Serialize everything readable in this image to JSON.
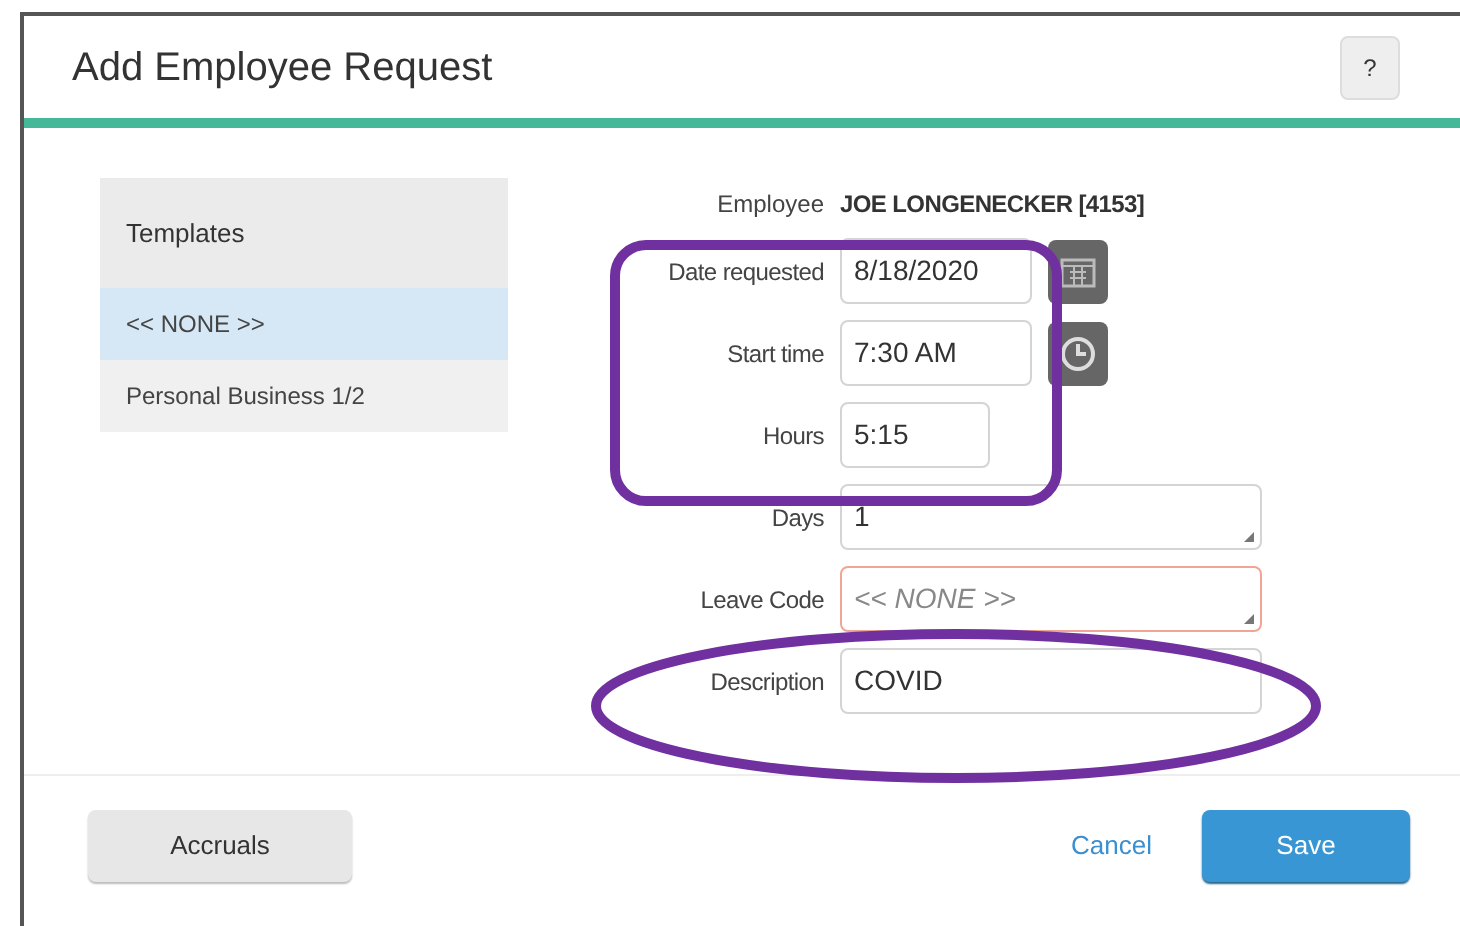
{
  "dialog": {
    "title": "Add Employee Request",
    "help_button": "?"
  },
  "templates": {
    "header": "Templates",
    "items": [
      {
        "label": "<< NONE >>",
        "selected": true
      },
      {
        "label": "Personal Business 1/2",
        "selected": false
      }
    ]
  },
  "employee": {
    "label": "Employee",
    "value": "JOE LONGENECKER [4153]"
  },
  "fields": [
    {
      "label": "Date requested",
      "value": "8/18/2020",
      "kind": "date",
      "invalid": false
    },
    {
      "label": "Start time",
      "value": "7:30 AM",
      "kind": "time",
      "invalid": false
    },
    {
      "label": "Hours",
      "value": "5:15",
      "kind": "duration",
      "invalid": false
    },
    {
      "label": "Days",
      "value": "1",
      "kind": "textarea",
      "invalid": false
    },
    {
      "label": "Leave Code",
      "value": "<< NONE >>",
      "kind": "select",
      "invalid": true
    },
    {
      "label": "Description",
      "value": "COVID",
      "kind": "text",
      "invalid": false
    }
  ],
  "footer": {
    "accruals": "Accruals",
    "cancel": "Cancel",
    "save": "Save"
  }
}
